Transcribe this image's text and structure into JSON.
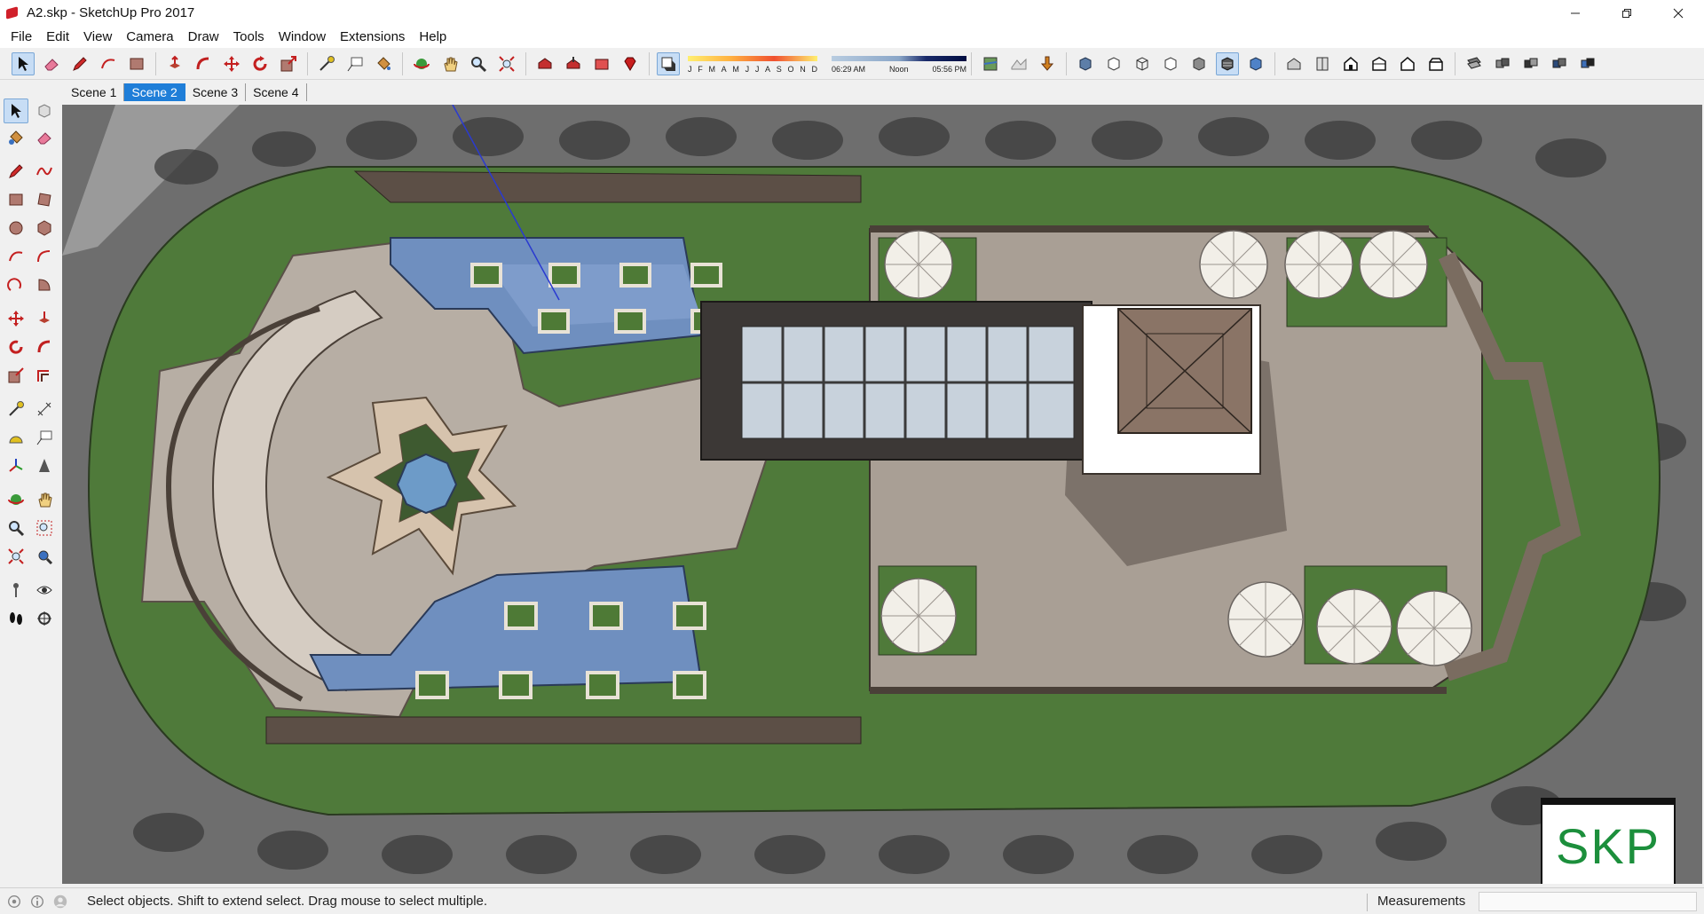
{
  "window": {
    "title": "A2.skp - SketchUp Pro 2017"
  },
  "menu": {
    "items": [
      "File",
      "Edit",
      "View",
      "Camera",
      "Draw",
      "Tools",
      "Window",
      "Extensions",
      "Help"
    ]
  },
  "toolbar": {
    "shadow_months": [
      "J",
      "F",
      "M",
      "A",
      "M",
      "J",
      "J",
      "A",
      "S",
      "O",
      "N",
      "D"
    ],
    "shadow_time": {
      "start": "06:29 AM",
      "mid": "Noon",
      "end": "05:56 PM"
    }
  },
  "scenes": {
    "tabs": [
      "Scene 1",
      "Scene 2",
      "Scene 3",
      "Scene 4"
    ],
    "active": "Scene 2"
  },
  "viewport": {
    "watermark": "SKP"
  },
  "status": {
    "message": "Select objects. Shift to extend select. Drag mouse to select multiple.",
    "measurements_label": "Measurements",
    "measurements_value": ""
  },
  "colors": {
    "accent": "#1f7ed8",
    "lawn": "#4f7a3a",
    "water": "#6f8fbf",
    "paving": "#b7aea4",
    "watermark": "#1c8f3c"
  }
}
